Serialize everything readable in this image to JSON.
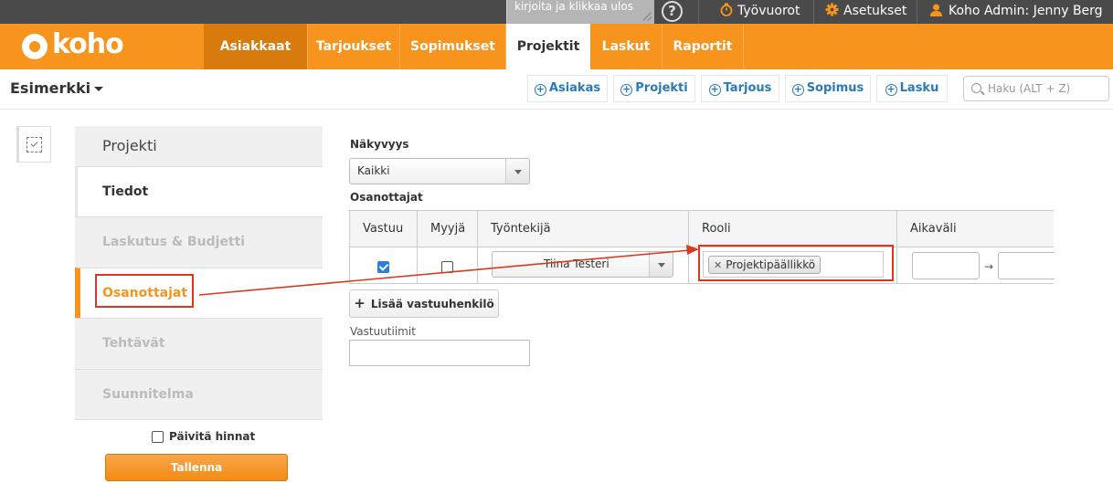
{
  "topbar": {
    "notes_placeholder": "kirjoita ja klikkaa ulos",
    "help_glyph": "?",
    "shifts_label": "Työvuorot",
    "settings_label": "Asetukset",
    "user_label": "Koho Admin: Jenny Berg"
  },
  "brand": {
    "logo_text": "koho",
    "accent": "#f7941d"
  },
  "nav": {
    "tabs": [
      {
        "label": "Asiakkaat"
      },
      {
        "label": "Tarjoukset"
      },
      {
        "label": "Sopimukset"
      },
      {
        "label": "Projektit"
      },
      {
        "label": "Laskut"
      },
      {
        "label": "Raportit"
      }
    ]
  },
  "subbar": {
    "company": "Esimerkki",
    "quick_actions": [
      {
        "label": "Asiakas"
      },
      {
        "label": "Projekti"
      },
      {
        "label": "Tarjous"
      },
      {
        "label": "Sopimus"
      },
      {
        "label": "Lasku"
      }
    ],
    "search_placeholder": "Haku (ALT + Z)"
  },
  "panel": {
    "title": "Projekti",
    "items": [
      {
        "label": "Tiedot"
      },
      {
        "label": "Laskutus & Budjetti"
      },
      {
        "label": "Osanottajat"
      },
      {
        "label": "Tehtävät"
      },
      {
        "label": "Suunnitelma"
      }
    ],
    "update_prices_label": "Päivitä hinnat",
    "save_label": "Tallenna"
  },
  "form": {
    "visibility_label": "Näkyvyys",
    "visibility_value": "Kaikki",
    "participants_label": "Osanottajat",
    "table": {
      "headers": [
        "Vastuu",
        "Myyjä",
        "Työntekijä",
        "Rooli",
        "Aikaväli"
      ],
      "row": {
        "responsible_checked": true,
        "seller_checked": false,
        "employee": "Tiina Testeri",
        "role_tag": "Projektipäällikkö",
        "range_arrow": "→"
      }
    },
    "add_responsible_label": "Lisää vastuuhenkilö",
    "teams_label": "Vastuutiimit"
  },
  "annotation_color": "#d93a1f"
}
